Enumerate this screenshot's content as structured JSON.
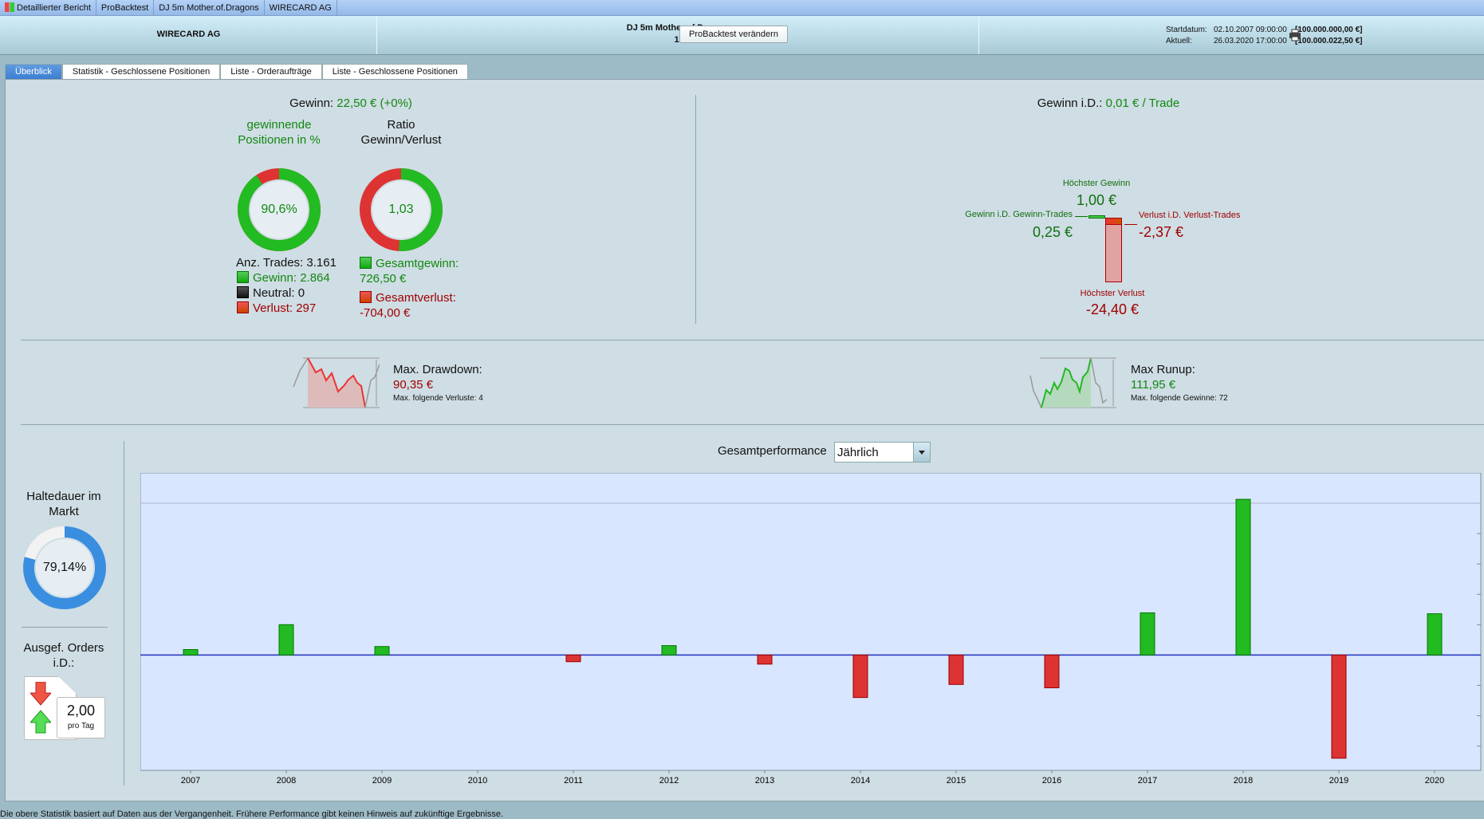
{
  "topbar": {
    "items": [
      "Detaillierter Bericht",
      "ProBacktest",
      "DJ 5m Mother.of.Dragons",
      "WIRECARD AG"
    ]
  },
  "header": {
    "instrument": "WIRECARD AG",
    "system": "DJ 5m Mother.of.Dragons",
    "timeframe": "1 Stunde",
    "change_button": "ProBacktest verändern",
    "start_label": "Startdatum:",
    "start_date": "02.10.2007 09:00:00",
    "start_value": "[100.000.000,00 €]",
    "current_label": "Aktuell:",
    "current_date": "26.03.2020 17:00:00",
    "current_value": "[100.000.022,50 €]"
  },
  "tabs": [
    "Überblick",
    "Statistik - Geschlossene Positionen",
    "Liste - Orderaufträge",
    "Liste - Geschlossene Positionen"
  ],
  "summary": {
    "gewinn_label": "Gewinn:",
    "gewinn_value": "22,50 € (+0%)",
    "win_title": "gewinnende Positionen in %",
    "win_pct": "90,6%",
    "win_fraction": 0.906,
    "ratio_title": "Ratio Gewinn/Verlust",
    "ratio_value": "1,03",
    "ratio_green_fraction": 0.508,
    "trades": "Anz. Trades: 3.161",
    "wins": "Gewinn: 2.864",
    "neutral": "Neutral: 0",
    "losses": "Verlust: 297",
    "total_gain_label": "Gesamtgewinn:",
    "total_gain": "726,50 €",
    "total_loss_label": "Gesamtverlust:",
    "total_loss": "-704,00 €"
  },
  "per_trade": {
    "title_label": "Gewinn i.D.:",
    "title_value": "0,01 € / Trade",
    "max_gain_label": "Höchster Gewinn",
    "max_gain": "1,00 €",
    "avg_gain_label": "Gewinn i.D. Gewinn-Trades",
    "avg_gain": "0,25 €",
    "avg_loss_label": "Verlust i.D. Verlust-Trades",
    "avg_loss": "-2,37 €",
    "max_loss_label": "Höchster Verlust",
    "max_loss": "-24,40 €"
  },
  "drawdown": {
    "label": "Max. Drawdown:",
    "value": "90,35 €",
    "sub": "Max. folgende Verluste: 4"
  },
  "runup": {
    "label": "Max Runup:",
    "value": "111,95 €",
    "sub": "Max. folgende Gewinne: 72"
  },
  "holding": {
    "label": "Haltedauer im Markt",
    "value": "79,14%",
    "fraction": 0.7914
  },
  "orders": {
    "label": "Ausgef. Orders i.D.:",
    "value": "2,00",
    "unit": "pro Tag"
  },
  "performance": {
    "label": "Gesamtperformance",
    "period": "Jährlich"
  },
  "colors": {
    "green": "#22bb22",
    "red": "#dd3333",
    "blue": "#3a8ee0",
    "chart_bg": "#d9e6ff",
    "zero_line": "#2233bb"
  },
  "chart_data": {
    "type": "bar",
    "title": "Gesamtperformance",
    "xlabel": "",
    "ylabel": "",
    "categories": [
      "2007",
      "2008",
      "2009",
      "2010",
      "2011",
      "2012",
      "2013",
      "2014",
      "2015",
      "2016",
      "2017",
      "2018",
      "2019",
      "2020"
    ],
    "values": [
      0.18,
      1.0,
      0.28,
      0,
      -0.22,
      0.31,
      -0.3,
      -1.4,
      -0.97,
      -1.08,
      1.39,
      5.13,
      -3.4,
      1.36
    ],
    "ylim": [
      -3.8,
      6
    ],
    "grid": true
  },
  "footer": "Die obere Statistik basiert auf Daten aus der Vergangenheit. Frühere Performance gibt keinen Hinweis auf zukünftige Ergebnisse."
}
